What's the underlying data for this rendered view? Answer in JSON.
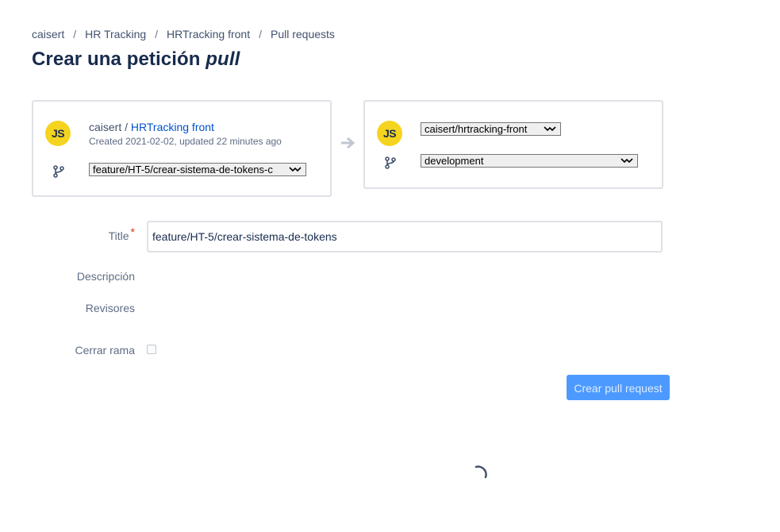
{
  "breadcrumb": [
    "caisert",
    "HR Tracking",
    "HRTracking front",
    "Pull requests"
  ],
  "breadcrumb_separator": "/",
  "page_title": {
    "text": "Crear una petición ",
    "emphasis": "pull"
  },
  "source": {
    "avatar_initials": "JS",
    "avatar_color": "#f5d41f",
    "owner": "caisert",
    "separator": " / ",
    "repo_name": "HRTracking front",
    "meta": "Created 2021-02-02, updated 22 minutes ago",
    "branch": "feature/HT-5/crear-sistema-de-tokens-c"
  },
  "destination": {
    "avatar_initials": "JS",
    "repo_select": "caisert/hrtracking-front",
    "branch_select": "development"
  },
  "form": {
    "title_label": "Title",
    "required_mark": "*",
    "title_value": "feature/HT-5/crear-sistema-de-tokens",
    "description_label": "Descripción",
    "reviewers_label": "Revisores",
    "close_branch_label": "Cerrar rama",
    "close_branch_checked": false,
    "submit_label": "Crear pull request"
  },
  "colors": {
    "primary_link": "#0052cc",
    "submit_bg": "#4c9aff",
    "required": "#de350b"
  },
  "icons": [
    "branch-icon",
    "arrow-right-icon",
    "chevron-down-icon",
    "loading-spinner-icon"
  ]
}
